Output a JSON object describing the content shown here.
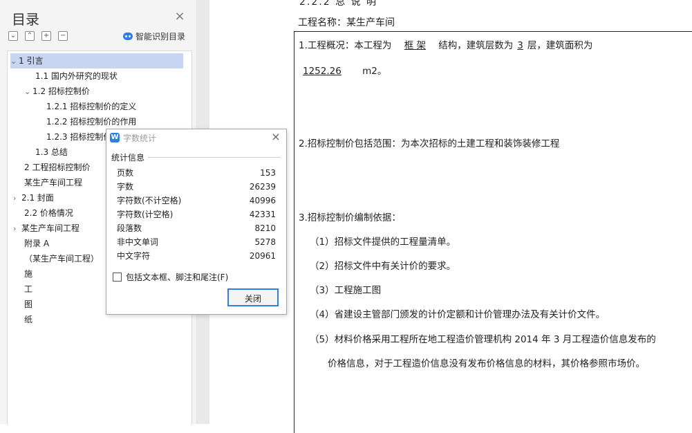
{
  "sidebar": {
    "title": "目录",
    "close_icon": "close-icon",
    "tools": [
      "⌄",
      "⌃",
      "+",
      "−"
    ],
    "smart_label": "智能识别目录",
    "toc": [
      {
        "label": "1   引言",
        "chev": "⌄",
        "selected": true
      },
      {
        "label": "1.1 国内外研究的现状"
      },
      {
        "label": "1.2 招标控制价",
        "chev": "⌄"
      },
      {
        "label": "1.2.1 招标控制价的定义"
      },
      {
        "label": "1.2.2 招标控制价的作用"
      },
      {
        "label": "1.2.3 招标控制价"
      },
      {
        "label": "1.3 总结"
      },
      {
        "label": "2   工程招标控制价"
      },
      {
        "label": "某生产车间工程"
      },
      {
        "label": "2.1   封面",
        "chev": "›"
      },
      {
        "label": "2.2  价格情况"
      },
      {
        "label": "某生产车间工程",
        "chev": "›"
      },
      {
        "label": "附录 A"
      },
      {
        "label": "（某生产车间工程）"
      },
      {
        "label": "施"
      },
      {
        "label": "工"
      },
      {
        "label": "图"
      },
      {
        "label": "纸"
      }
    ]
  },
  "document": {
    "heading": "2.2.2  总  说  明",
    "project_name": "工程名称：某生产车间",
    "p1_prefix": "1.工程概况：本工程为",
    "p1_structure": "框  架",
    "p1_mid": "结构，建筑层数为",
    "p1_floors": "3",
    "p1_mid2": "层，建筑面积为",
    "p1_area": "1252.26",
    "p1_unit": "m2。",
    "p2": "2.招标控制价包括范围：为本次招标的土建工程和装饰装修工程",
    "p3": "3.招标控制价编制依据：",
    "items": [
      "（1）招标文件提供的工程量清单。",
      "（2）招标文件中有关计价的要求。",
      "（3）工程施工图",
      "（4）省建设主管部门颁发的计价定额和计价管理办法及有关计价文件。",
      "（5）材料价格采用工程所在地工程造价管理机构 2014 年 3 月工程造价信息发布的"
    ],
    "item5_cont": "价格信息，对于工程造价信息没有发布价格信息的材料，其价格参照市场价。"
  },
  "dialog": {
    "title": "字数统计",
    "group_label": "统计信息",
    "stats": [
      {
        "label": "页数",
        "value": "153"
      },
      {
        "label": "字数",
        "value": "26239"
      },
      {
        "label": "字符数(不计空格)",
        "value": "40996"
      },
      {
        "label": "字符数(计空格)",
        "value": "42331"
      },
      {
        "label": "段落数",
        "value": "8210"
      },
      {
        "label": "非中文单词",
        "value": "5278"
      },
      {
        "label": "中文字符",
        "value": "20961"
      }
    ],
    "checkbox_label": "包括文本框、脚注和尾注(F)",
    "close_button": "关闭",
    "accent": "#2f7fe0"
  }
}
